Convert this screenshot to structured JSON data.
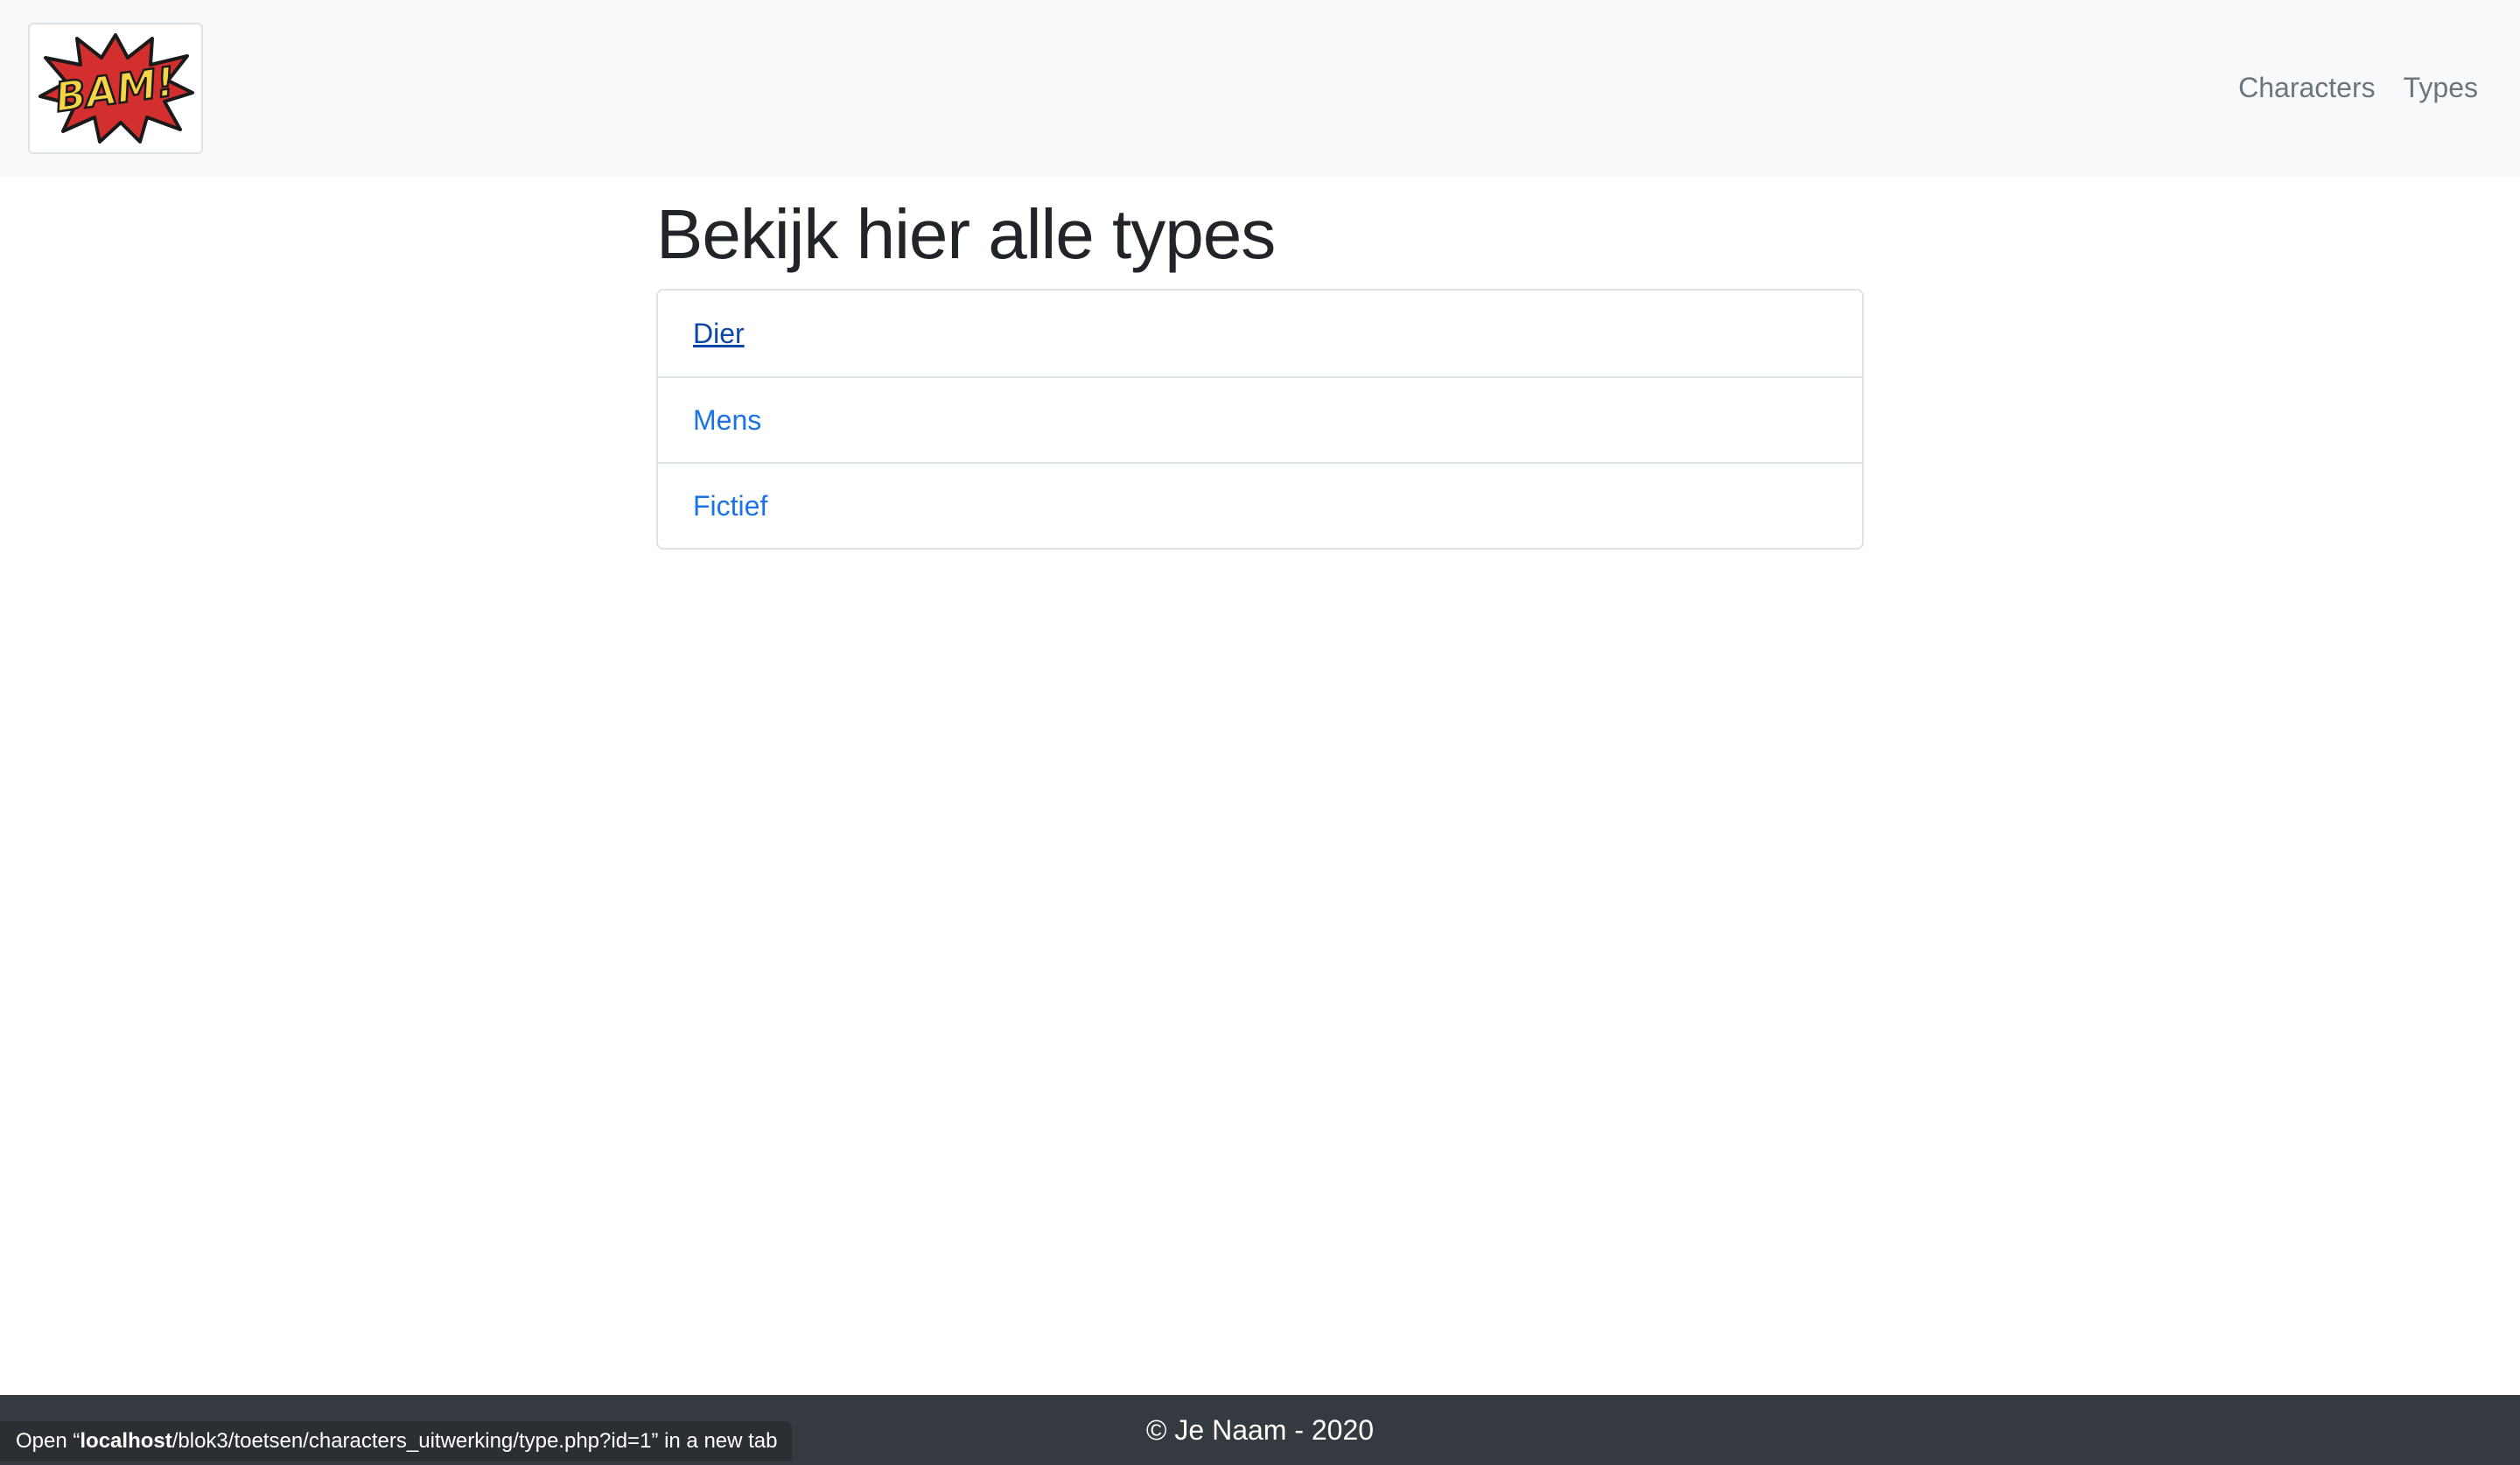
{
  "navbar": {
    "logo_text": "BAM!",
    "links": [
      {
        "label": "Characters"
      },
      {
        "label": "Types"
      }
    ]
  },
  "main": {
    "title": "Bekijk hier alle types",
    "types": [
      {
        "label": "Dier"
      },
      {
        "label": "Mens"
      },
      {
        "label": "Fictief"
      }
    ]
  },
  "footer": {
    "text": "© Je Naam - 2020"
  },
  "status_bar": {
    "prefix": "Open “",
    "host": "localhost",
    "path": "/blok3/toetsen/characters_uitwerking/type.php?id=1",
    "suffix": "” in a new tab"
  },
  "colors": {
    "navbar_bg": "#f8f9fa",
    "link": "#1a73e8",
    "link_hover": "#0a47a8",
    "footer_bg": "#343a40",
    "logo_burst": "#d32f2f",
    "logo_text": "#f5d547"
  }
}
